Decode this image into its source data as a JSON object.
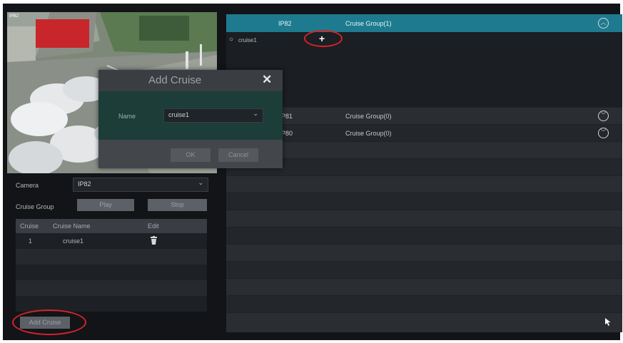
{
  "preview": {
    "corner_label": "IPB2"
  },
  "left_panel": {
    "camera_label": "Camera",
    "camera_value": "IP82",
    "cruise_group_label": "Cruise Group",
    "play_label": "Play",
    "stop_label": "Stop",
    "table": {
      "headers": [
        "Cruise",
        "Cruise Name",
        "Edit"
      ],
      "rows": [
        {
          "cruise": "1",
          "name": "cruise1"
        }
      ]
    },
    "add_cruise_label": "Add Cruise"
  },
  "right_panel": {
    "groups": [
      {
        "channel": "IP82",
        "group": "Cruise Group(1)",
        "expanded": true
      },
      {
        "channel": "IP81",
        "group": "Cruise Group(0)",
        "expanded": false
      },
      {
        "channel": "IP80",
        "group": "Cruise Group(0)",
        "expanded": false
      }
    ],
    "visible_channel_fragments": [
      "P81",
      "P80"
    ],
    "cruise_item": "cruise1",
    "add_symbol": "+"
  },
  "dialog": {
    "title": "Add Cruise",
    "close_symbol": "✕",
    "name_label": "Name",
    "name_value": "cruise1",
    "ok_label": "OK",
    "cancel_label": "Cancel"
  },
  "colors": {
    "accent": "#1e7b8f",
    "highlight_ring": "#d8222a",
    "background": "#121418"
  },
  "icons": [
    "chevron-down-icon",
    "chevron-up-icon",
    "trash-icon",
    "close-icon",
    "plus-icon",
    "refresh-icon",
    "cursor-icon"
  ]
}
